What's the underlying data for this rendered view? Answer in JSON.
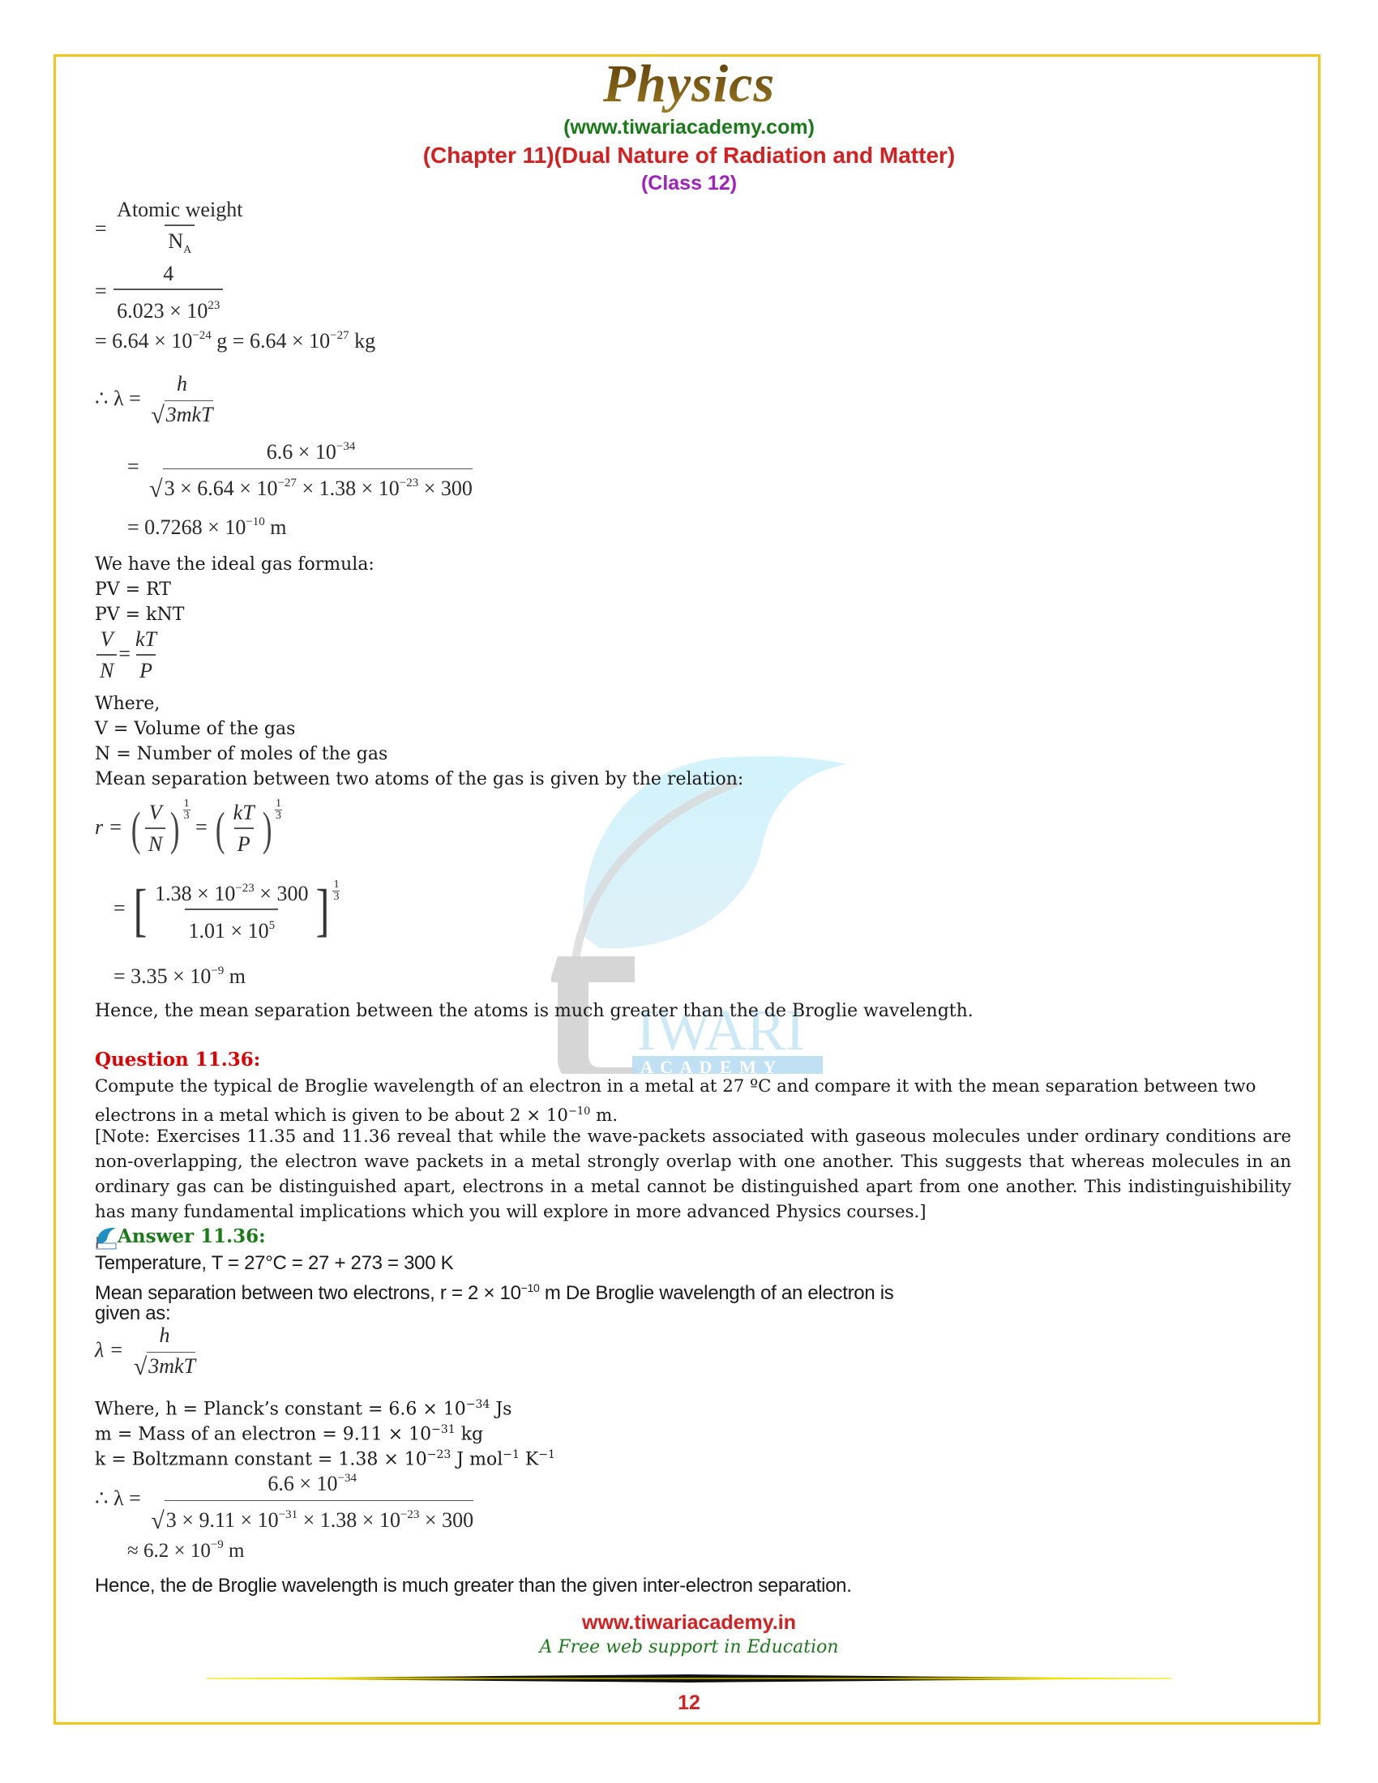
{
  "header": {
    "title": "Physics",
    "website": "(www.tiwariacademy.com)",
    "chapter": "(Chapter 11)(Dual Nature of Radiation and Matter)",
    "class": "(Class 12)"
  },
  "colors": {
    "border": "#f5c518",
    "title": "#6b4a0e",
    "website": "#1a7a1a",
    "chapter": "#d42020",
    "class": "#a020c0",
    "question": "#e00000",
    "answer": "#1a7a1a"
  },
  "part1": {
    "mass_eq1": {
      "lead": "=",
      "num": "Atomic weight",
      "den": "N",
      "den_sub": "A"
    },
    "mass_eq2": {
      "lead": "=",
      "num": "4",
      "den": "6.023 × 10",
      "den_sup": "23"
    },
    "mass_eq3": {
      "a": "= 6.64 × 10",
      "a_sup": "−24",
      "b": " g = 6.64 × 10",
      "b_sup": "−27",
      "c": " kg"
    },
    "lambda_eq": {
      "lead": "∴ λ =",
      "num": "h",
      "den": "3mkT"
    },
    "lambda_sub": {
      "lead": "=",
      "num": "6.6 × 10",
      "num_sup": "−34",
      "den": [
        "3 × 6.64 × 10",
        "−27",
        " × 1.38 × 10",
        "−23",
        " × 300"
      ]
    },
    "lambda_result": {
      "a": "= 0.7268 × 10",
      "sup": "−10",
      "b": " m"
    },
    "ideal_gas_intro": "We have the ideal gas formula:",
    "eq_pv_rt": "PV = RT",
    "eq_pv_knt": "PV = kNT",
    "vn_eq": {
      "l_num": "V",
      "l_den": "N",
      "eq": "=",
      "r_num": "kT",
      "r_den": "P"
    },
    "where": "Where,",
    "def_v": "V = Volume of the gas",
    "def_n": "N = Number of moles of the gas",
    "mean_sep_intro": "Mean separation between two atoms of the gas is given by the relation:",
    "r_eq": {
      "lead": "r =",
      "a_num": "V",
      "a_den": "N",
      "eq": "=",
      "b_num": "kT",
      "b_den": "P",
      "exp_num": "1",
      "exp_den": "3"
    },
    "r_sub": {
      "lead": "=",
      "num": [
        "1.38 × 10",
        "−23",
        " × 300"
      ],
      "den": [
        "1.01 × 10",
        "5"
      ],
      "exp_num": "1",
      "exp_den": "3"
    },
    "r_result": {
      "a": "= 3.35 × 10",
      "sup": "−9",
      "b": " m"
    },
    "conclusion": "Hence, the mean separation between the atoms is much greater than the de Broglie wavelength."
  },
  "question": {
    "heading": "Question 11.36:",
    "text_line1": "Compute the typical de Broglie wavelength of an electron in a metal at 27 ºC and compare it with the mean separation between two",
    "text_line2_a": "electrons in a metal which is given to be about 2 × 10",
    "text_line2_sup": "−10",
    "text_line2_b": " m.",
    "note": "[Note: Exercises 11.35 and 11.36 reveal that while the wave-packets associated with gaseous molecules under ordinary conditions are non-overlapping, the electron wave packets in a metal strongly overlap with one another. This suggests that whereas molecules in an ordinary gas can be distinguished apart, electrons in a metal cannot be distinguished apart from one another. This indistinguishibility has many fundamental implications which you will explore in more advanced Physics courses.]"
  },
  "answer": {
    "icon": "tiwari-leaf-icon",
    "heading": "Answer 11.36:",
    "temperature": "Temperature, T = 27°C = 27 + 273 = 300 K",
    "mean_sep_a": "Mean separation between two electrons, r = 2 × 10",
    "mean_sep_sup": "−10",
    "mean_sep_b": " m De Broglie wavelength of an electron is",
    "given_as": "given as:",
    "lambda_eq": {
      "lead": "λ =",
      "num": "h",
      "den": "3mkT"
    },
    "def_h_a": "Where, h = Planck’s constant = 6.6 × 10",
    "def_h_sup": "−34",
    "def_h_b": " Js",
    "def_m_a": "m = Mass of an electron = 9.11 × 10",
    "def_m_sup": "−31",
    "def_m_b": " kg",
    "def_k_a": "k = Boltzmann constant = 1.38 × 10",
    "def_k_sup": "−23",
    "def_k_b": " J mol",
    "def_k_sup2": "−1",
    "def_k_c": " K",
    "def_k_sup3": "−1",
    "lambda_sub": {
      "lead": "∴ λ =",
      "num": "6.6 × 10",
      "num_sup": "−34",
      "den": [
        "3 × 9.11 × 10",
        "−31",
        " × 1.38 × 10",
        "−23",
        " × 300"
      ]
    },
    "lambda_result": {
      "a": "≈ 6.2 × 10",
      "sup": "−9",
      "b": " m"
    },
    "conclusion": "Hence, the de Broglie wavelength is much greater than the given inter-electron separation."
  },
  "watermark": {
    "letters": "IWARI",
    "academy": "A C A D E M Y"
  },
  "footer": {
    "url": "www.tiwariacademy.in",
    "tagline": "A Free web support in Education",
    "page_number": "12"
  }
}
